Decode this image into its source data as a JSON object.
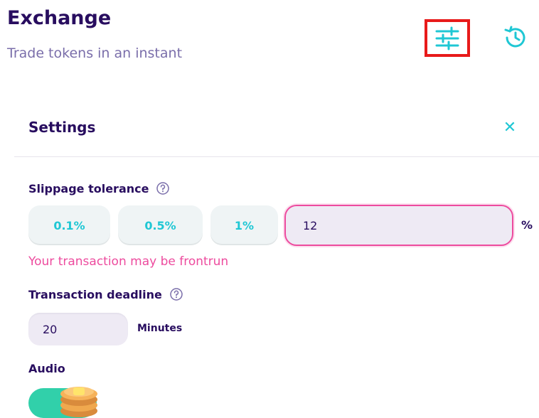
{
  "header": {
    "title": "Exchange",
    "subtitle": "Trade tokens in an instant",
    "settings_icon": "sliders-icon",
    "history_icon": "history-icon"
  },
  "settings": {
    "title": "Settings",
    "close_icon": "close-icon",
    "slippage": {
      "label": "Slippage tolerance",
      "options": [
        "0.1%",
        "0.5%",
        "1%"
      ],
      "custom_value": "12",
      "unit": "%",
      "warning": "Your transaction may be frontrun"
    },
    "deadline": {
      "label": "Transaction deadline",
      "value": "20",
      "unit": "Minutes"
    },
    "audio": {
      "label": "Audio",
      "enabled": true
    }
  },
  "colors": {
    "primary": "#1fc7d4",
    "text": "#280d5f",
    "subtle": "#7a6eaa",
    "warning": "#ed4b9e",
    "success": "#31d0aa",
    "highlight_box": "#e81a1a"
  }
}
